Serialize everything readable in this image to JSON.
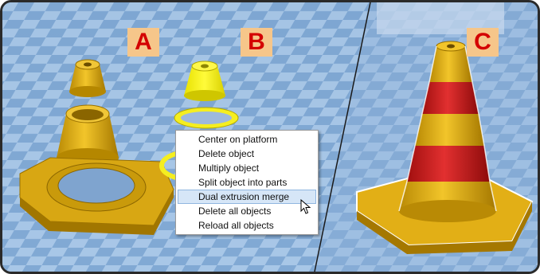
{
  "panels": [
    {
      "label": "A"
    },
    {
      "label": "B"
    },
    {
      "label": "C"
    }
  ],
  "context_menu": {
    "items": [
      {
        "label": "Center on platform"
      },
      {
        "label": "Delete object"
      },
      {
        "label": "Multiply object"
      },
      {
        "label": "Split object into parts"
      },
      {
        "label": "Dual extrusion merge",
        "highlighted": true
      },
      {
        "label": "Delete all objects"
      },
      {
        "label": "Reload all objects"
      }
    ]
  },
  "colors": {
    "platform": "#8fb3da",
    "cone_yellow": "#e8b81a",
    "cone_red": "#d21f1f",
    "label_bg": "#f6c68a",
    "label_text": "#d40000"
  },
  "icons": [
    "mouse-cursor-icon"
  ]
}
